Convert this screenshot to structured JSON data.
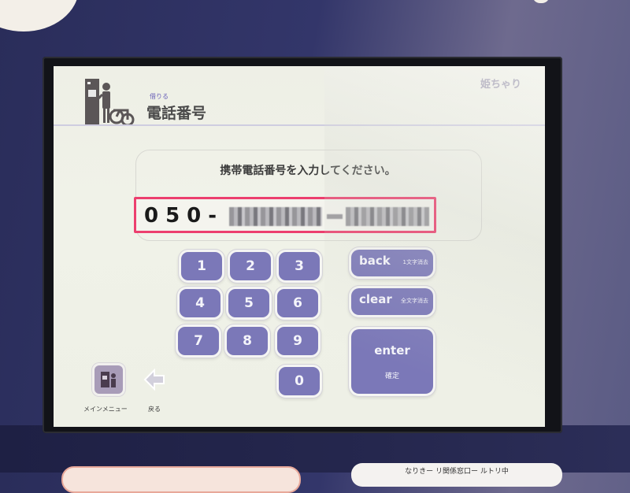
{
  "screen": {
    "header": {
      "sub_label": "借りる",
      "title": "電話番号",
      "brand": "姫ちゃり",
      "pictogram_icon": "rental-kiosk-person-bicycle-icon"
    },
    "prompt": "携帯電話番号を入力してください。",
    "phone_input": {
      "visible_prefix": "050-",
      "masked_segments": [
        "XXXX",
        "XXXX"
      ],
      "separator": "-",
      "highlight_color": "#ec3f6e"
    },
    "keypad": {
      "keys": [
        "1",
        "2",
        "3",
        "4",
        "5",
        "6",
        "7",
        "8",
        "9",
        "0"
      ]
    },
    "actions": {
      "back": {
        "label": "back",
        "sub": "1文字消去"
      },
      "clear": {
        "label": "clear",
        "sub": "全文字消去"
      },
      "enter": {
        "label": "enter",
        "sub": "確定"
      }
    },
    "nav": {
      "main_menu": {
        "label": "メインメニュー",
        "icon": "main-menu-icon"
      },
      "return": {
        "label": "戻る",
        "icon": "back-arrow-icon"
      }
    },
    "colors": {
      "button": "#7b78b8",
      "screen_bg": "#eeefe6",
      "kiosk_body": "#2a2d5a"
    }
  },
  "kiosk": {
    "sticker_text": "なりきー リ関係窓口ー ルトリ中"
  }
}
